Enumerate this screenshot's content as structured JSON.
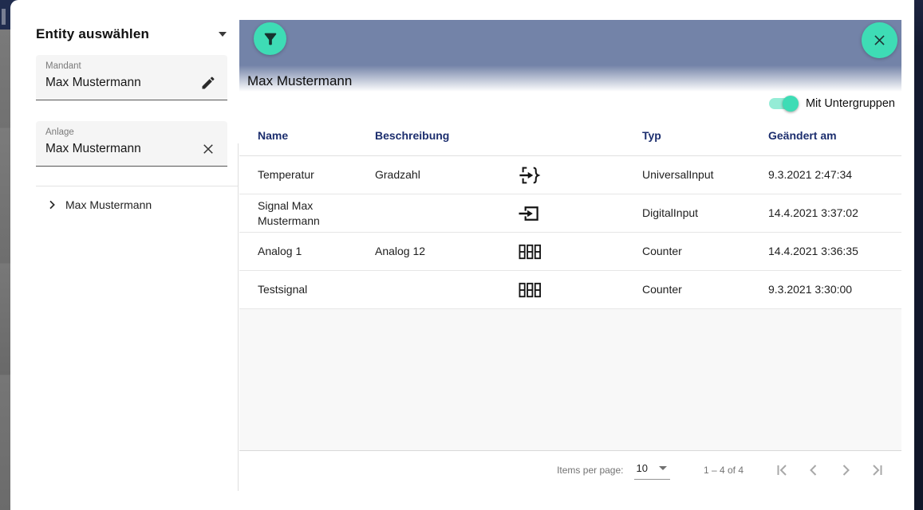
{
  "colors": {
    "accent": "#3edcb5",
    "accent_dark_icon": "#17332f",
    "topbar": "#7383a8",
    "header_text": "#1c2e6e",
    "backdrop_navy": "#202c4e"
  },
  "sidebar": {
    "title": "Entity auswählen",
    "fields": [
      {
        "label": "Mandant",
        "value": "Max Mustermann",
        "icon": "edit-icon"
      },
      {
        "label": "Anlage",
        "value": "Max Mustermann",
        "icon": "clear-icon"
      }
    ],
    "tree": [
      {
        "label": "Max Mustermann"
      }
    ]
  },
  "panel": {
    "title": "Max Mustermann",
    "toggle": {
      "label": "Mit Untergruppen",
      "on": true
    },
    "table": {
      "headers": {
        "name": "Name",
        "beschreibung": "Beschreibung",
        "typ": "Typ",
        "geaendert_am": "Geändert am"
      },
      "rows": [
        {
          "name": "Temperatur",
          "beschreibung": "Gradzahl",
          "icon": "universal-input-icon",
          "typ": "UniversalInput",
          "geaendert_am": "9.3.2021 2:47:34"
        },
        {
          "name": "Signal Max Mustermann",
          "beschreibung": "",
          "icon": "digital-input-icon",
          "typ": "DigitalInput",
          "geaendert_am": "14.4.2021 3:37:02"
        },
        {
          "name": "Analog 1",
          "beschreibung": "Analog 12",
          "icon": "counter-icon",
          "typ": "Counter",
          "geaendert_am": "14.4.2021 3:36:35"
        },
        {
          "name": "Testsignal",
          "beschreibung": "",
          "icon": "counter-icon",
          "typ": "Counter",
          "geaendert_am": "9.3.2021 3:30:00"
        }
      ]
    },
    "paginator": {
      "items_per_page_label": "Items per page:",
      "page_size": "10",
      "range_label": "1 – 4 of 4"
    }
  }
}
